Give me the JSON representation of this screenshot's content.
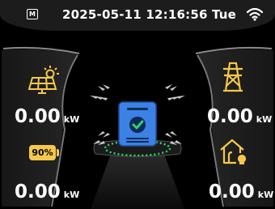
{
  "status_bar": {
    "mode_letter": "M",
    "datetime": "2025-05-11 12:16:56 Tue",
    "wifi": "wifi-icon"
  },
  "solar": {
    "icon": "solar-panel-icon",
    "value": "0.00",
    "unit": "kW"
  },
  "grid": {
    "icon": "power-tower-icon",
    "value": "0.00",
    "unit": "kW"
  },
  "battery": {
    "icon": "battery-icon",
    "percent": "90%",
    "value": "0.00",
    "unit": "kW"
  },
  "home": {
    "icon": "home-icon",
    "value": "0.00",
    "unit": "kW"
  },
  "inverter": {
    "icon": "inverter-icon",
    "status_icon": "check-icon"
  },
  "colors": {
    "accent": "#f6c84a",
    "inverter": "#3b82e4",
    "check": "#2fd36c"
  }
}
